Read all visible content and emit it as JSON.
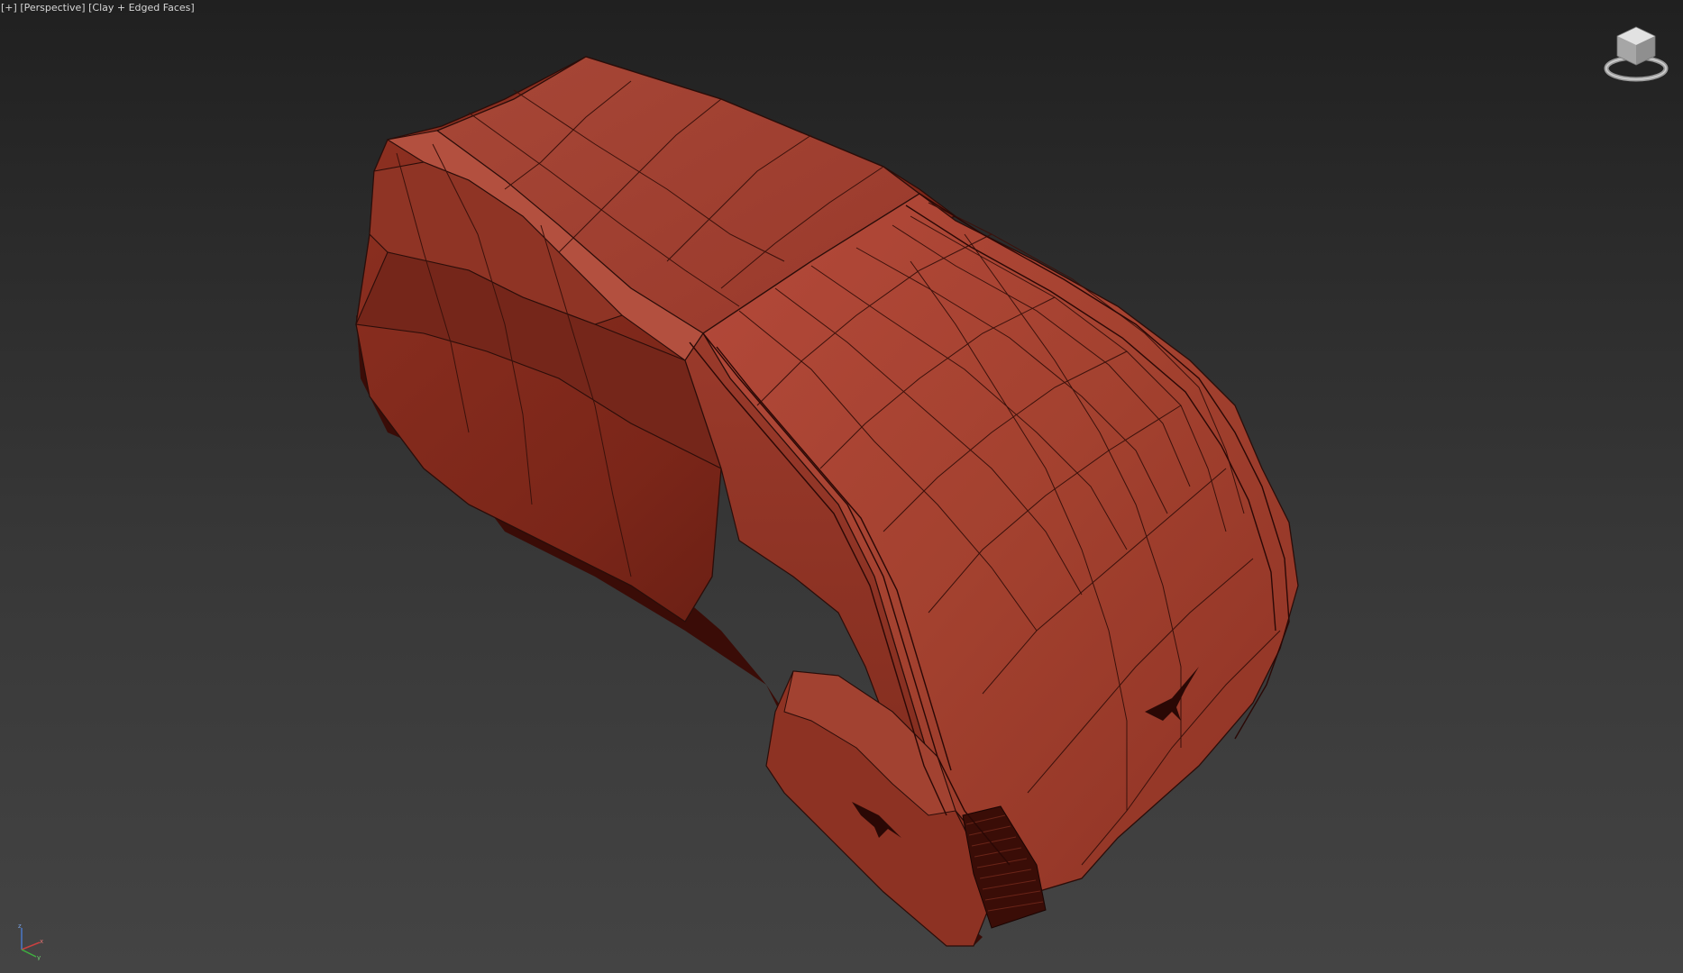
{
  "viewport": {
    "label": {
      "plus": "[+]",
      "view": "[Perspective]",
      "shading": "[Clay + Edged Faces]"
    },
    "viewcube_icon": "viewcube-icon",
    "axis": {
      "z": "z",
      "x": "x",
      "y": "y"
    },
    "model": {
      "description": "red clay vehicle mesh with edged faces",
      "color": "#9c3a2f",
      "edge_color": "#2a0d09"
    }
  }
}
